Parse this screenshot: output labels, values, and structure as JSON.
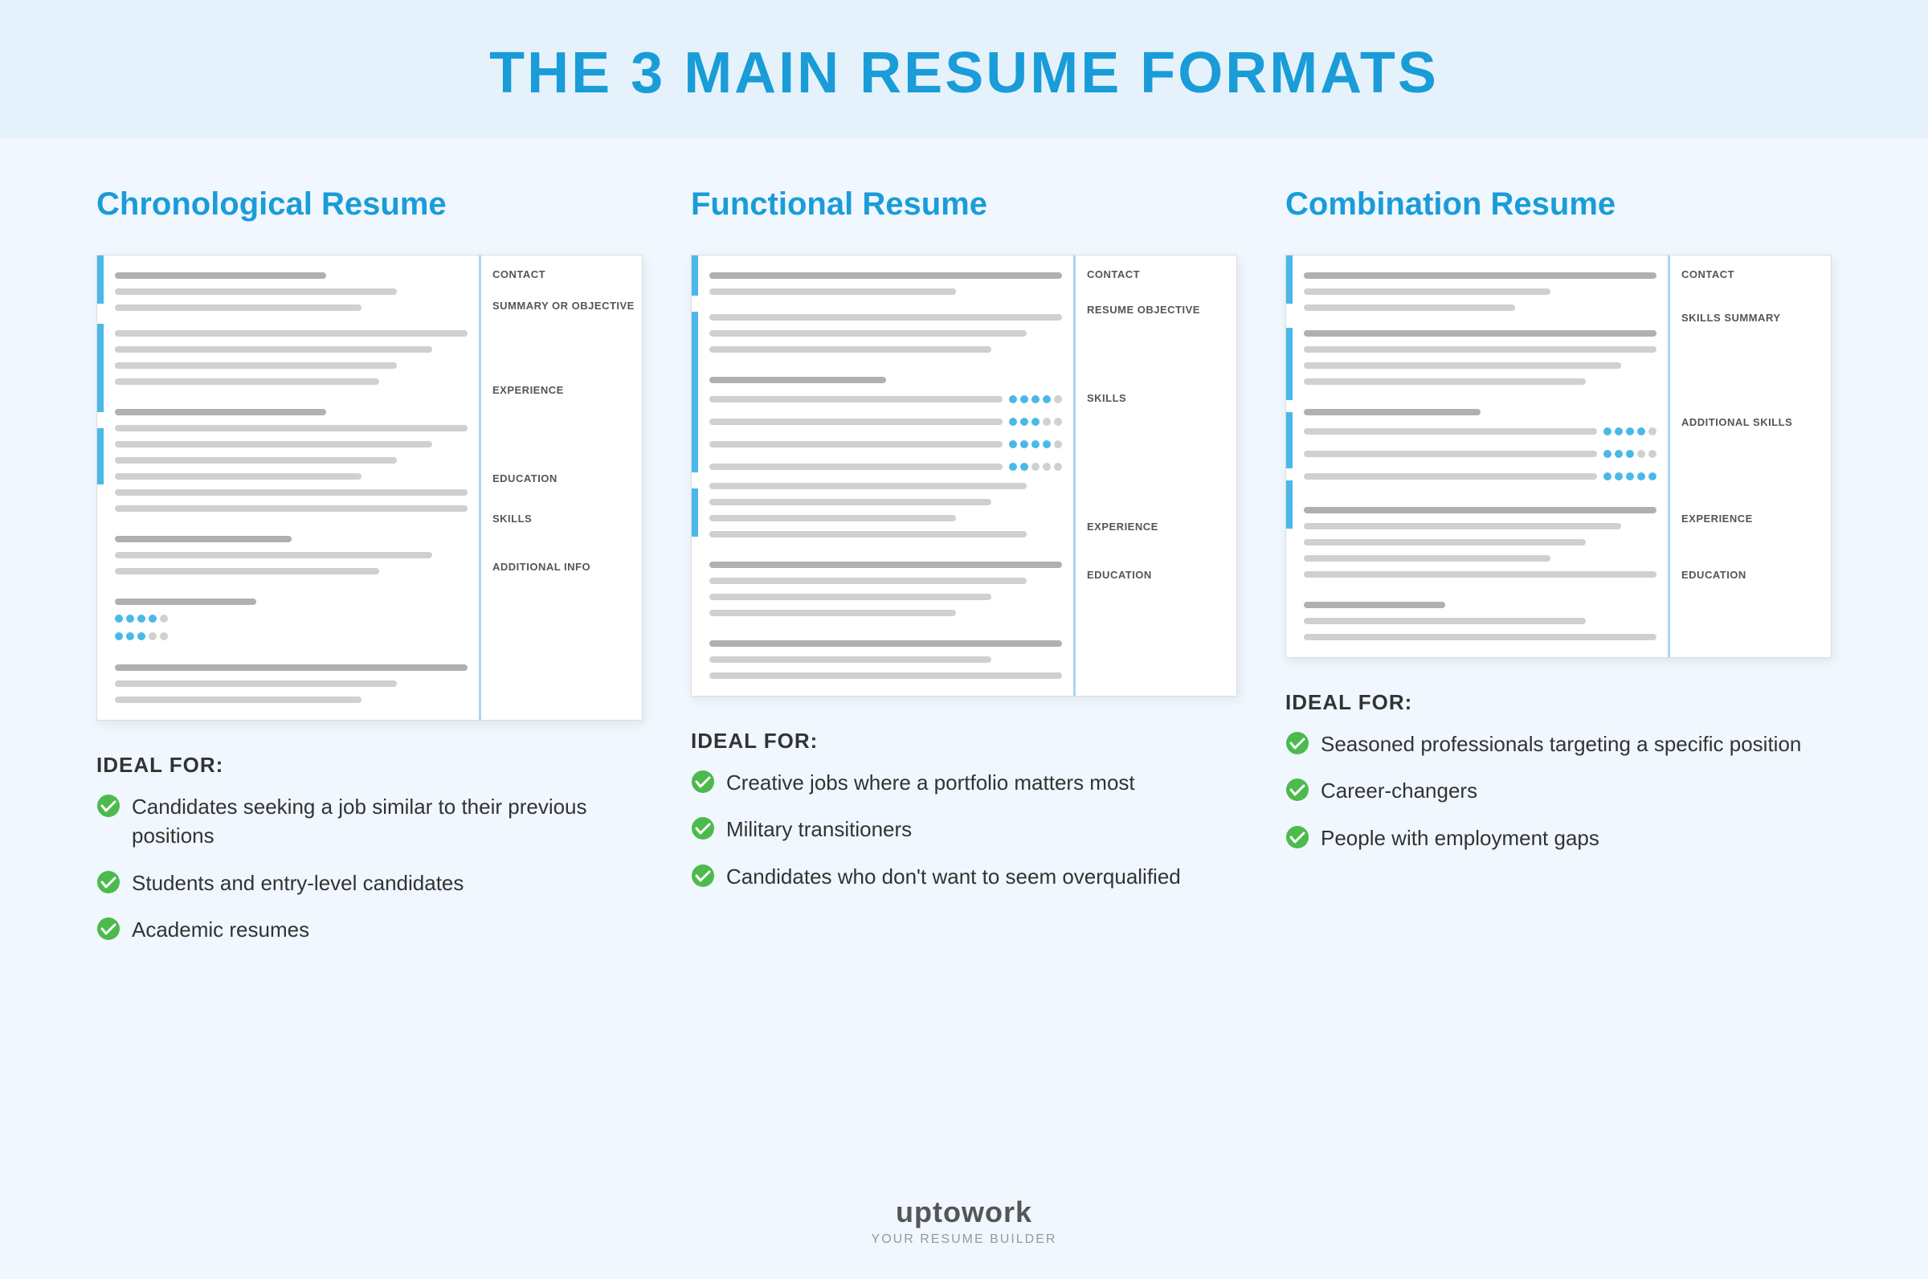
{
  "page": {
    "title": "THE 3 MAIN RESUME FORMATS",
    "background_color": "#f0f7ff"
  },
  "formats": [
    {
      "id": "chronological",
      "title": "Chronological Resume",
      "labels": [
        "CONTACT",
        "SUMMARY OR OBJECTIVE",
        "EXPERIENCE",
        "EDUCATION",
        "SKILLS",
        "ADDITIONAL INFO"
      ],
      "ideal_for_label": "IDEAL FOR:",
      "items": [
        "Candidates seeking a job similar to their previous positions",
        "Students and entry-level candidates",
        "Academic resumes"
      ]
    },
    {
      "id": "functional",
      "title": "Functional Resume",
      "labels": [
        "CONTACT",
        "RESUME OBJECTIVE",
        "SKILLS",
        "EXPERIENCE",
        "EDUCATION"
      ],
      "ideal_for_label": "IDEAL FOR:",
      "items": [
        "Creative jobs where a portfolio matters most",
        "Military transitioners",
        "Candidates who don't want to seem overqualified"
      ]
    },
    {
      "id": "combination",
      "title": "Combination Resume",
      "labels": [
        "CONTACT",
        "SKILLS SUMMARY",
        "ADDITIONAL SKILLS",
        "EXPERIENCE",
        "EDUCATION"
      ],
      "ideal_for_label": "IDEAL FOR:",
      "items": [
        "Seasoned professionals targeting a specific position",
        "Career-changers",
        "People with employment gaps"
      ]
    }
  ],
  "footer": {
    "logo": "uptowork",
    "tagline": "YOUR RESUME BUILDER"
  },
  "check_icon_color": "#4cba4c"
}
